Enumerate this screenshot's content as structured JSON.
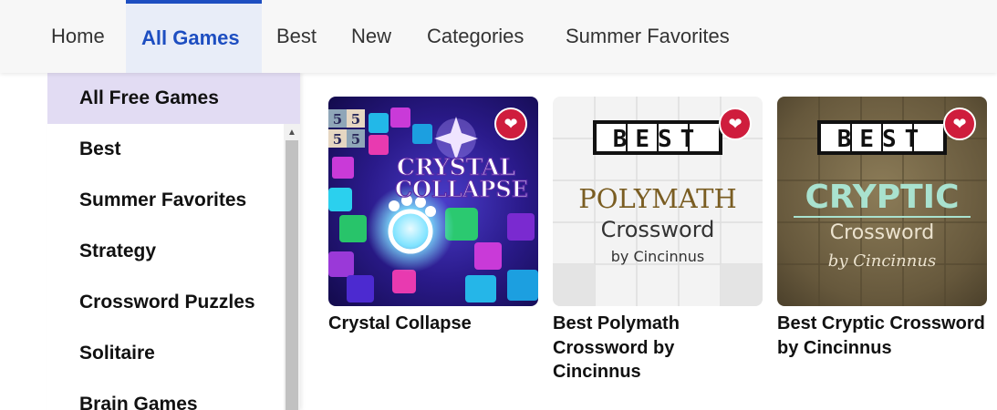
{
  "nav": {
    "tabs": [
      {
        "label": "Home"
      },
      {
        "label": "All Games",
        "active": true
      },
      {
        "label": "Best"
      },
      {
        "label": "New"
      },
      {
        "label": "Categories"
      },
      {
        "label": "Summer Favorites"
      }
    ],
    "active_color": "#1d4ec1"
  },
  "sidebar": {
    "items": [
      {
        "label": "All Free Games",
        "selected": true
      },
      {
        "label": "Best"
      },
      {
        "label": "Summer Favorites"
      },
      {
        "label": "Strategy"
      },
      {
        "label": "Crossword Puzzles"
      },
      {
        "label": "Solitaire"
      },
      {
        "label": "Brain Games"
      }
    ],
    "selected_color": "#e2dcf3"
  },
  "games": [
    {
      "title": "Crystal Collapse",
      "art_text": [
        "CRYSTAL",
        "COLLAPSE"
      ],
      "tile_numbers": [
        "5",
        "5",
        "5",
        "5"
      ],
      "favorite_icon": "heart-icon"
    },
    {
      "title": "Best Polymath Crossword by Cincinnus",
      "art_badge": "BEST",
      "art_text": [
        "POLYMATH",
        "Crossword",
        "by Cincinnus"
      ],
      "favorite_icon": "heart-icon"
    },
    {
      "title": "Best Cryptic Crossword by Cincinnus",
      "art_badge": "BEST",
      "art_text": [
        "CRYPTIC",
        "Crossword",
        "by Cincinnus"
      ],
      "favorite_icon": "heart-icon"
    }
  ],
  "colors": {
    "favorite": "#cf1d3d"
  }
}
